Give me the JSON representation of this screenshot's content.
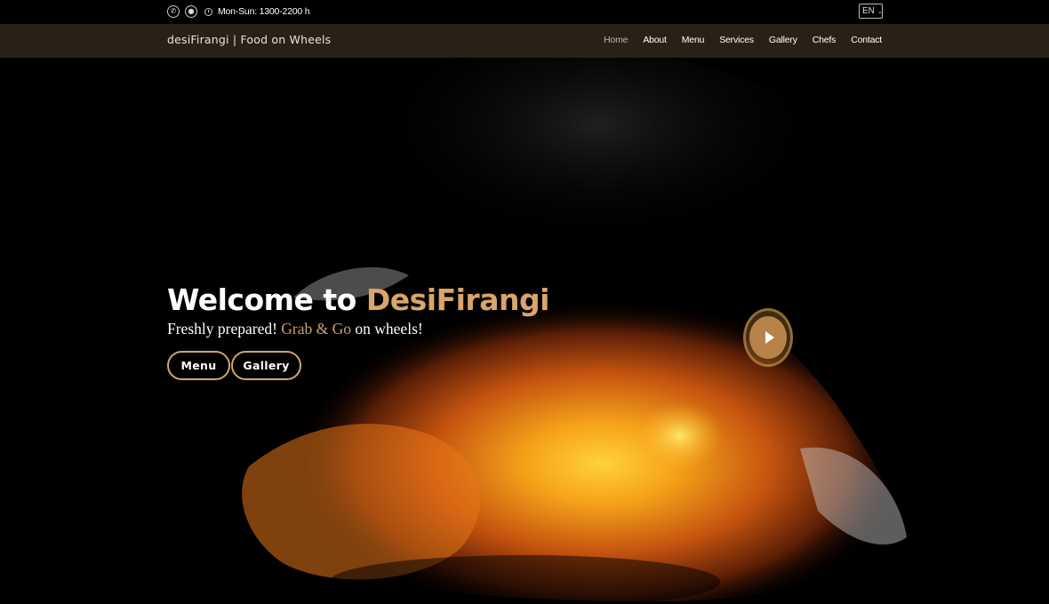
{
  "topbar": {
    "icons": [
      "phone-icon",
      "whatsapp-icon",
      "clock-icon"
    ],
    "hours": "Mon-Sun: 1300-2200 h",
    "language": "EN"
  },
  "navbar": {
    "brand": "desiFirangi | Food on Wheels",
    "links": [
      "Home",
      "About",
      "Menu",
      "Services",
      "Gallery",
      "Chefs",
      "Contact"
    ],
    "active": "Home"
  },
  "hero": {
    "headline_prefix": "Welcome to ",
    "headline_accent": "DesiFirangi",
    "subtitle_prefix": "Freshly prepared! ",
    "subtitle_accent": "Grab & Go",
    "subtitle_suffix": " on wheels!",
    "buttons": [
      "Menu",
      "Gallery"
    ]
  },
  "colors": {
    "accent": "#d9a56a",
    "navbar_bg": "#2a2116",
    "page_bg": "#000000"
  }
}
